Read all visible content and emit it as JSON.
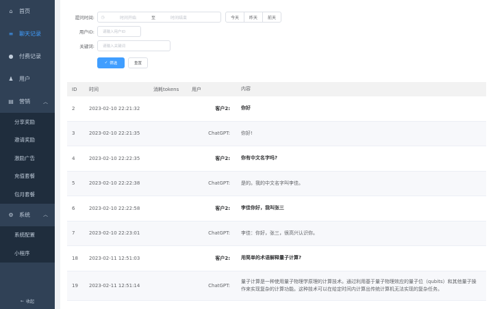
{
  "sidebar": {
    "items": [
      {
        "label": "首页",
        "icon": "home-icon"
      },
      {
        "label": "聊天记录",
        "icon": "list-icon"
      },
      {
        "label": "付费记录",
        "icon": "money-bag-icon"
      },
      {
        "label": "用户",
        "icon": "user-icon"
      },
      {
        "label": "营销",
        "icon": "wallet-icon"
      },
      {
        "label": "系统",
        "icon": "gear-icon"
      }
    ],
    "marketing_sub": [
      "分享奖励",
      "邀请奖励",
      "激励广告",
      "充值套餐",
      "包月套餐"
    ],
    "system_sub": [
      "系统配置",
      "小程序"
    ],
    "collapse_label": "收起"
  },
  "filters": {
    "time_label": "提问时间:",
    "start_placeholder": "时间开始",
    "range_sep": "至",
    "end_placeholder": "时间结束",
    "quick": [
      "今天",
      "昨天",
      "前天"
    ],
    "user_id_label": "用户ID:",
    "user_id_placeholder": "请输入用户ID",
    "keyword_label": "关键词:",
    "keyword_placeholder": "请输入关键词",
    "search_label": "筛选",
    "reset_label": "重置"
  },
  "table": {
    "headers": {
      "id": "ID",
      "time": "时间",
      "tokens": "消耗tokens",
      "user": "用户",
      "content": "内容"
    },
    "rows": [
      {
        "id": "2",
        "time": "2023-02-10 22:21:32",
        "tokens": "",
        "user": "客户2:",
        "content": "你好"
      },
      {
        "id": "3",
        "time": "2023-02-10 22:21:35",
        "tokens": "",
        "user": "ChatGPT:",
        "content": "你好!"
      },
      {
        "id": "4",
        "time": "2023-02-10 22:22:35",
        "tokens": "",
        "user": "客户2:",
        "content": "你有中文名字吗?"
      },
      {
        "id": "5",
        "time": "2023-02-10 22:22:38",
        "tokens": "",
        "user": "ChatGPT:",
        "content": "是的。我的中文名字叫李佳。"
      },
      {
        "id": "6",
        "time": "2023-02-10 22:22:58",
        "tokens": "",
        "user": "客户2:",
        "content": "李佳你好，我叫张三"
      },
      {
        "id": "7",
        "time": "2023-02-10 22:23:01",
        "tokens": "",
        "user": "ChatGPT:",
        "content": "李佳：你好，张三，很高兴认识你。"
      },
      {
        "id": "18",
        "time": "2023-02-11 12:51:03",
        "tokens": "",
        "user": "客户2:",
        "content": "用简单的术语解释量子计算?"
      },
      {
        "id": "19",
        "time": "2023-02-11 12:51:14",
        "tokens": "",
        "user": "ChatGPT:",
        "content": "量子计算是一种使用量子物理学原理的计算技术。通过利用基于量子物理效应的量子位（qubits）和其他量子操作来实现复杂的计算功能。这种技术可以在给定时间内计算出传统计算机无法实现的复杂任务。"
      }
    ]
  },
  "colors": {
    "sidebar_bg": "#304156",
    "accent": "#409eff"
  }
}
